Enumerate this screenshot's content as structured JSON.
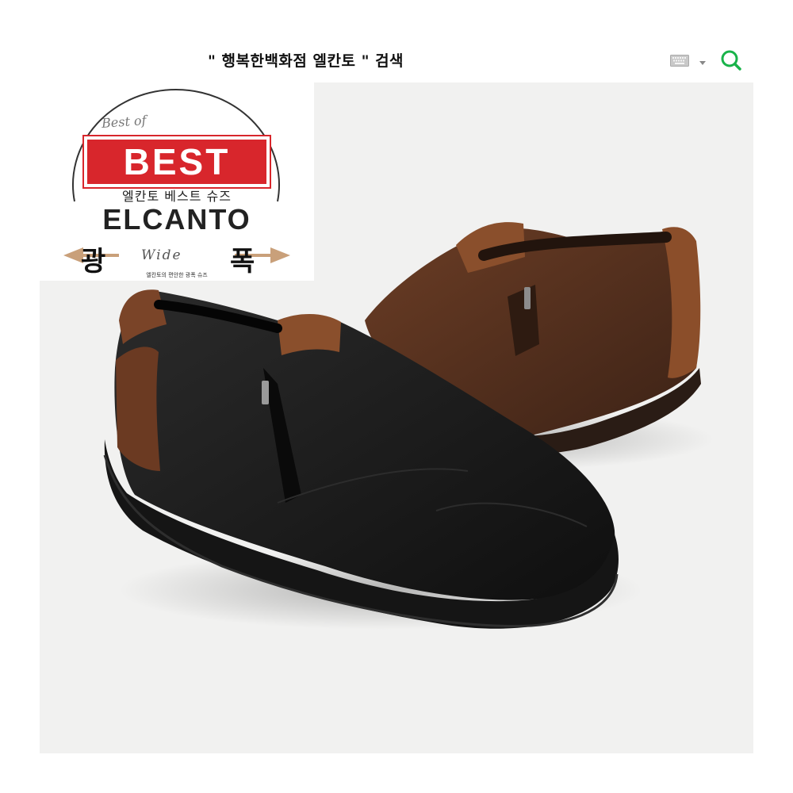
{
  "search": {
    "query": "\" 행복한백화점 엘칸토 \" 검색",
    "keyboard_icon": "keyboard-icon",
    "dropdown_icon": "caret-down-icon",
    "search_icon": "magnifier-icon",
    "accent_color": "#19b34a"
  },
  "badge": {
    "best_of": "Best of",
    "best": "BEST",
    "subtitle": "엘칸토 베스트 슈즈",
    "brand": "ELCANTO",
    "wide_left": "광",
    "wide_script": "Wide",
    "wide_right": "폭",
    "tagline": "엘칸토의 편안한 광폭 슈즈",
    "red": "#d8262c"
  }
}
